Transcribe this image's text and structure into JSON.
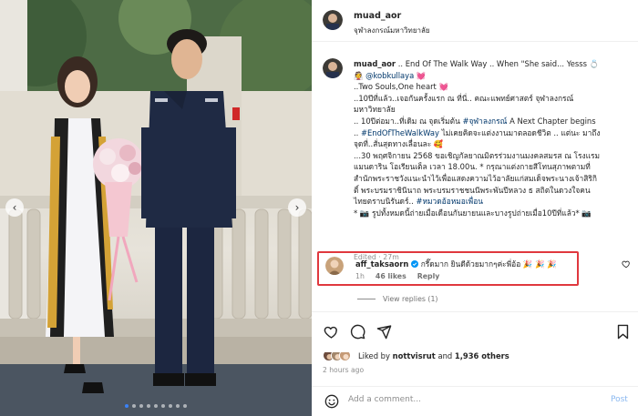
{
  "photo": {
    "alt_people": [
      "bride-in-graduation-gown",
      "groom-in-navy-uniform"
    ],
    "carousel_dots": 9,
    "active_dot": 0
  },
  "header": {
    "username": "muad_aor",
    "location": "จุฬาลงกรณ์มหาวิทยาลัย"
  },
  "caption": {
    "username": "muad_aor",
    "lines": [
      ".. End Of The Walk Way .. When \"She said... Yesss 💍",
      "👰",
      "@kobkullaya",
      "💓",
      "..Two Souls,One heart 💓",
      "..10ปีที่แล้ว..เจอกันครั้งแรก ณ ที่นี่.. คณะแพทย์ศาสตร์ จุฬาลงกรณ์",
      "มหาวิทยาลัย",
      ".. 10ปีต่อมา..ที่เดิม ณ จุดเริ่มต้น",
      "#จุฬาลงกรณ์",
      "A Next Chapter begins",
      "..",
      "#EndOfTheWalkWay",
      "ไม่เคยคิดจะแต่งงานมาตลอดชีวิต .. แต่นะ มาถึง",
      "จุดที่..สั่นสุดทางเลื่อนละ 🥰",
      "...30 พฤศจิกายน 2568 ขอเชิญกัลยาณมิตรร่วมงานมงคลสมรส ณ โรงแรม",
      "แมนดาริน โอเรียนเต็ล เวลา 18.00น. * กรุณาแต่งกายสีโทนสุภาพตามที่",
      "สำนักพระราชวังแนะนำไว้เพื่อแสดงความไว้อาลัยแก่สมเด็จพระนางเจ้าสิริกิ",
      "ติ์ พระบรมราชินีนาถ พระบรมราชชนนีพระพันปีหลวง ธ สถิตในดวงใจคน",
      "ไทยตราบนิรันดร์..",
      "#หมวดอ้อหมอเพื่อน",
      "* 📷 รูปทั้งหมดนี้ถ่ายเมื่อเดือนกันยายนและบางรูปถ่ายเมื่อ10ปีที่แล้ว* 📷"
    ],
    "edited": "Edited",
    "age": "27m"
  },
  "comment": {
    "username": "aff_taksaorn",
    "verified": true,
    "text": "กรี๊ดมาก ยินดีด้วยมากๆค่ะพี่อ้อ 🎉 🎉 🎉",
    "age": "1h",
    "likes": "46 likes",
    "reply": "Reply",
    "view_replies": "View replies (1)"
  },
  "actions": {
    "liked_by_prefix": "Liked by",
    "liked_by_user": "nottvisrut",
    "liked_by_joiner": "and",
    "liked_by_count": "1,936 others",
    "time": "2 hours ago"
  },
  "add_comment": {
    "placeholder": "Add a comment...",
    "post": "Post"
  },
  "colors": {
    "link": "#00376b",
    "verified": "#0095f6",
    "highlight_box": "#e0383e",
    "muted": "#8e8e8e"
  },
  "icons": [
    "heart-icon",
    "comment-icon",
    "share-icon",
    "bookmark-icon",
    "emoji-icon",
    "verified-icon",
    "chevron-left-icon",
    "chevron-right-icon"
  ]
}
